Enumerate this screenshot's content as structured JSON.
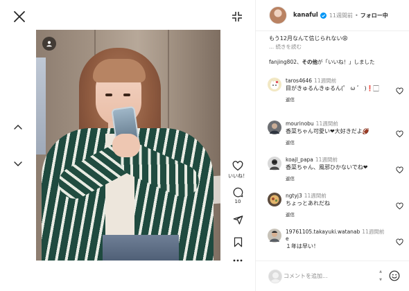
{
  "post": {
    "author": "kanaful",
    "time": "11週間前",
    "follow_label": "フォロー中",
    "caption": "もう12月なんて信じられない😩",
    "caption_more": "... 続きを読む",
    "liked_by_user": "fanjing802",
    "liked_by_text": "、",
    "liked_by_others": "その他",
    "liked_by_suffix": "が「いいね！」しました",
    "like_count_label": "いいね！",
    "comment_count": "10"
  },
  "comments": [
    {
      "user": "taros4646",
      "time": "11週間前",
      "text": "目がきゅるんきゅるん(゜ ω ゛ )❗🏻",
      "reply": "返信"
    },
    {
      "user": "mourinobu",
      "time": "11週間前",
      "text": "香菜ちゃん可愛い❤大好きだよ🏈",
      "reply": "返信"
    },
    {
      "user": "koajl_papa",
      "time": "11週間前",
      "text": "香菜ちゃん、風邪ひかないでね❤",
      "reply": "返信"
    },
    {
      "user": "ngtyj3",
      "time": "11週間前",
      "text": "ちょっとあれだね",
      "reply": "返信"
    },
    {
      "user": "19761105.takayuki.watanabe",
      "user_line1": "19761105.takayuki.watanab",
      "user_line2": "e",
      "time": "11週間前",
      "text": "１年は早い！",
      "reply": "返信"
    }
  ],
  "composer": {
    "placeholder": "コメントを追加..."
  },
  "icons": {
    "close": "close-icon",
    "collapse": "collapse-icon",
    "prev": "chevron-up-icon",
    "next": "chevron-down-icon",
    "like": "heart-icon",
    "comment": "comment-bubble-icon",
    "share": "paper-plane-icon",
    "save": "bookmark-icon",
    "more": "more-horizontal-icon",
    "user_tag": "user-tag-icon",
    "emoji": "emoji-smiley-icon"
  },
  "colors": {
    "text_primary": "#262626",
    "text_secondary": "#8e8e8e",
    "verified_blue": "#0095f6",
    "divider": "#efefef"
  }
}
